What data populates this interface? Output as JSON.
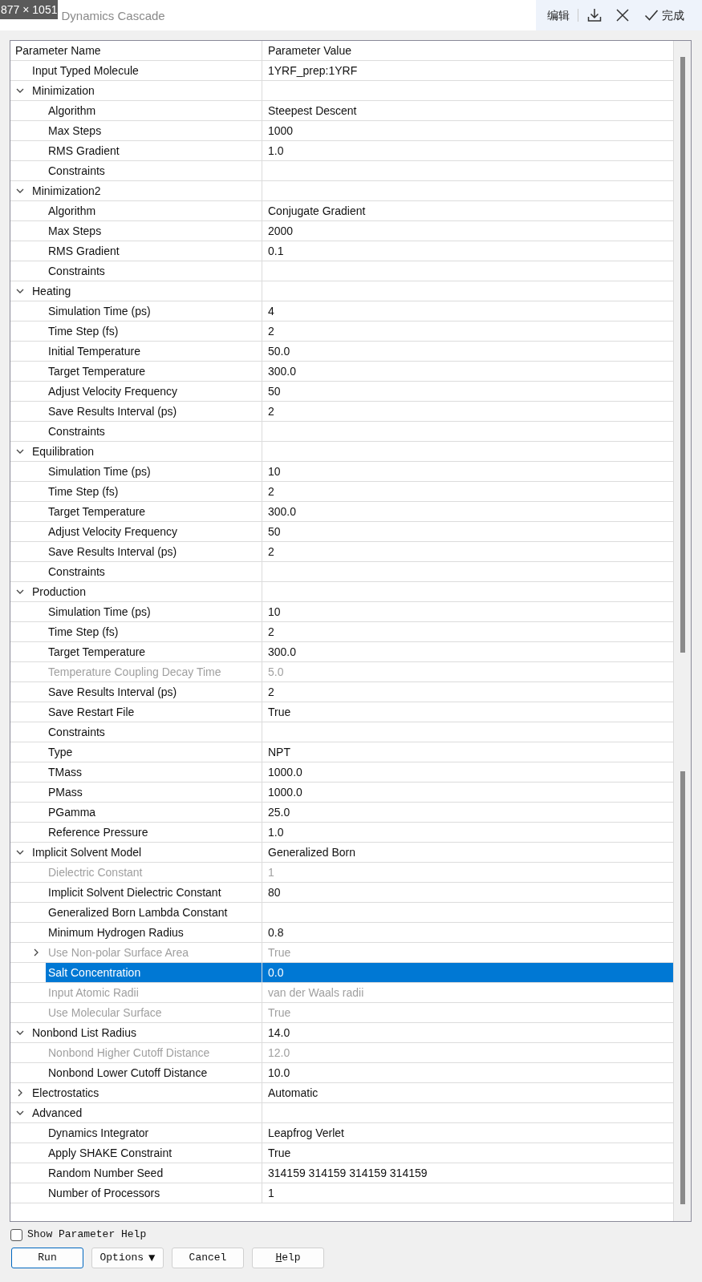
{
  "overlay_label": "877 × 1051",
  "window": {
    "title": "Dynamics Cascade"
  },
  "toolbar": {
    "edit": "编辑",
    "done": "完成"
  },
  "table": {
    "columns": [
      "Parameter Name",
      "Parameter Value"
    ],
    "rows": [
      {
        "name": "Input Typed Molecule",
        "value": "1YRF_prep:1YRF",
        "disabled": false,
        "selected": false
      },
      {
        "name": "Minimization",
        "expanded": true,
        "disabled": false,
        "selected": false,
        "children": [
          {
            "name": "Algorithm",
            "value": "Steepest Descent",
            "disabled": false,
            "selected": false
          },
          {
            "name": "Max Steps",
            "value": "1000",
            "disabled": false,
            "selected": false
          },
          {
            "name": "RMS Gradient",
            "value": "1.0",
            "disabled": false,
            "selected": false
          },
          {
            "name": "Constraints",
            "disabled": false,
            "selected": false
          }
        ]
      },
      {
        "name": "Minimization2",
        "expanded": true,
        "disabled": false,
        "selected": false,
        "children": [
          {
            "name": "Algorithm",
            "value": "Conjugate Gradient",
            "disabled": false,
            "selected": false
          },
          {
            "name": "Max Steps",
            "value": "2000",
            "disabled": false,
            "selected": false
          },
          {
            "name": "RMS Gradient",
            "value": "0.1",
            "disabled": false,
            "selected": false
          },
          {
            "name": "Constraints",
            "disabled": false,
            "selected": false
          }
        ]
      },
      {
        "name": "Heating",
        "expanded": true,
        "disabled": false,
        "selected": false,
        "children": [
          {
            "name": "Simulation Time (ps)",
            "value": "4",
            "disabled": false,
            "selected": false
          },
          {
            "name": "Time Step (fs)",
            "value": "2",
            "disabled": false,
            "selected": false
          },
          {
            "name": "Initial Temperature",
            "value": "50.0",
            "disabled": false,
            "selected": false
          },
          {
            "name": "Target Temperature",
            "value": "300.0",
            "disabled": false,
            "selected": false
          },
          {
            "name": "Adjust Velocity Frequency",
            "value": "50",
            "disabled": false,
            "selected": false
          },
          {
            "name": "Save Results Interval (ps)",
            "value": "2",
            "disabled": false,
            "selected": false
          },
          {
            "name": "Constraints",
            "disabled": false,
            "selected": false
          }
        ]
      },
      {
        "name": "Equilibration",
        "expanded": true,
        "disabled": false,
        "selected": false,
        "children": [
          {
            "name": "Simulation Time (ps)",
            "value": "10",
            "disabled": false,
            "selected": false
          },
          {
            "name": "Time Step (fs)",
            "value": "2",
            "disabled": false,
            "selected": false
          },
          {
            "name": "Target Temperature",
            "value": "300.0",
            "disabled": false,
            "selected": false
          },
          {
            "name": "Adjust Velocity Frequency",
            "value": "50",
            "disabled": false,
            "selected": false
          },
          {
            "name": "Save Results Interval (ps)",
            "value": "2",
            "disabled": false,
            "selected": false
          },
          {
            "name": "Constraints",
            "disabled": false,
            "selected": false
          }
        ]
      },
      {
        "name": "Production",
        "expanded": true,
        "disabled": false,
        "selected": false,
        "children": [
          {
            "name": "Simulation Time (ps)",
            "value": "10",
            "disabled": false,
            "selected": false
          },
          {
            "name": "Time Step (fs)",
            "value": "2",
            "disabled": false,
            "selected": false
          },
          {
            "name": "Target Temperature",
            "value": "300.0",
            "disabled": false,
            "selected": false
          },
          {
            "name": "Temperature Coupling Decay Time",
            "value": "5.0",
            "disabled": true,
            "selected": false
          },
          {
            "name": "Save Results Interval (ps)",
            "value": "2",
            "disabled": false,
            "selected": false
          },
          {
            "name": "Save Restart File",
            "value": "True",
            "disabled": false,
            "selected": false
          },
          {
            "name": "Constraints",
            "disabled": false,
            "selected": false
          },
          {
            "name": "Type",
            "value": "NPT",
            "disabled": false,
            "selected": false
          },
          {
            "name": "TMass",
            "value": "1000.0",
            "disabled": false,
            "selected": false
          },
          {
            "name": "PMass",
            "value": "1000.0",
            "disabled": false,
            "selected": false
          },
          {
            "name": "PGamma",
            "value": "25.0",
            "disabled": false,
            "selected": false
          },
          {
            "name": "Reference Pressure",
            "value": "1.0",
            "disabled": false,
            "selected": false
          }
        ]
      },
      {
        "name": "Implicit Solvent Model",
        "value": "Generalized Born",
        "expanded": true,
        "disabled": false,
        "selected": false,
        "children": [
          {
            "name": "Dielectric Constant",
            "value": "1",
            "disabled": true,
            "selected": false
          },
          {
            "name": "Implicit Solvent Dielectric Constant",
            "value": "80",
            "disabled": false,
            "selected": false
          },
          {
            "name": "Generalized Born Lambda Constant",
            "disabled": false,
            "selected": false
          },
          {
            "name": "Minimum Hydrogen Radius",
            "value": "0.8",
            "disabled": false,
            "selected": false
          },
          {
            "name": "Use Non-polar Surface Area",
            "value": "True",
            "expanded": false,
            "disabled": true,
            "selected": false
          },
          {
            "name": "Salt Concentration",
            "value": "0.0",
            "disabled": false,
            "selected": true
          },
          {
            "name": "Input Atomic Radii",
            "value": "van der Waals radii",
            "disabled": true,
            "selected": false
          },
          {
            "name": "Use Molecular Surface",
            "value": "True",
            "disabled": true,
            "selected": false
          }
        ]
      },
      {
        "name": "Nonbond List Radius",
        "value": "14.0",
        "expanded": true,
        "disabled": false,
        "selected": false,
        "children": [
          {
            "name": "Nonbond Higher Cutoff Distance",
            "value": "12.0",
            "disabled": true,
            "selected": false
          },
          {
            "name": "Nonbond Lower Cutoff Distance",
            "value": "10.0",
            "disabled": false,
            "selected": false
          }
        ]
      },
      {
        "name": "Electrostatics",
        "value": "Automatic",
        "expanded": false,
        "disabled": false,
        "selected": false
      },
      {
        "name": "Advanced",
        "expanded": true,
        "disabled": false,
        "selected": false,
        "children": [
          {
            "name": "Dynamics Integrator",
            "value": "Leapfrog Verlet",
            "disabled": false,
            "selected": false
          },
          {
            "name": "Apply SHAKE Constraint",
            "value": "True",
            "disabled": false,
            "selected": false
          },
          {
            "name": "Random Number Seed",
            "value": "314159 314159 314159 314159",
            "disabled": false,
            "selected": false
          },
          {
            "name": "Number of Processors",
            "value": "1",
            "disabled": false,
            "selected": false
          }
        ]
      }
    ]
  },
  "show_help": {
    "label": "Show Parameter Help",
    "checked": false
  },
  "buttons": [
    {
      "label": "Run",
      "default": true,
      "underline_first": false
    },
    {
      "label": "Options",
      "icon": "▼",
      "default": false,
      "underline_first": false
    },
    {
      "label": "Cancel",
      "default": false,
      "underline_first": false
    },
    {
      "label": "Help",
      "default": false,
      "underline_first": true
    }
  ]
}
